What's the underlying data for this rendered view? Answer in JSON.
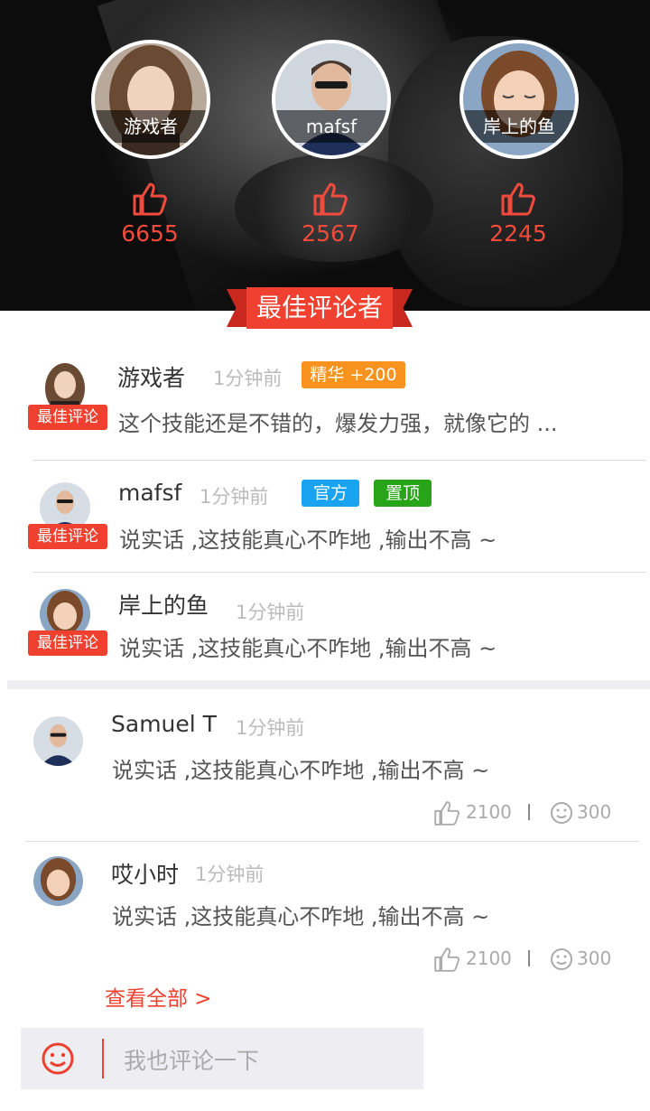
{
  "top_users": [
    {
      "name": "游戏者",
      "likes": "6655"
    },
    {
      "name": "mafsf",
      "likes": "2567"
    },
    {
      "name": "岸上的鱼",
      "likes": "2245"
    }
  ],
  "ribbon_title": "最佳评论者",
  "best_comments": [
    {
      "name": "游戏者",
      "time": "1分钟前",
      "tag": "最佳评论",
      "badges": [
        "精华 +200"
      ],
      "text": "这个技能还是不错的，爆发力强，就像它的 ..."
    },
    {
      "name": "mafsf",
      "time": "1分钟前",
      "tag": "最佳评论",
      "badges": [
        "官方",
        "置顶"
      ],
      "text": "说实话 ,这技能真心不咋地 ,输出不高 ~"
    },
    {
      "name": "岸上的鱼",
      "time": "1分钟前",
      "tag": "最佳评论",
      "badges": [],
      "text": "说实话 ,这技能真心不咋地 ,输出不高 ~"
    }
  ],
  "comments": [
    {
      "name": "Samuel T",
      "time": "1分钟前",
      "text": "说实话 ,这技能真心不咋地 ,输出不高 ~",
      "likes": "2100",
      "smiles": "300"
    },
    {
      "name": "哎小时",
      "time": "1分钟前",
      "text": "说实话 ,这技能真心不咋地 ,输出不高 ~",
      "likes": "2100",
      "smiles": "300"
    }
  ],
  "view_all": "查看全部 >",
  "comment_input": {
    "placeholder": "我也评论一下"
  },
  "icons": {
    "like": "thumbs-up-icon",
    "smile": "smile-icon",
    "emoji": "emoji-icon"
  },
  "colors": {
    "accent": "#f0402f",
    "badge_essence": "#f7931e",
    "badge_official": "#1aa3f0",
    "badge_pinned": "#27a417"
  }
}
